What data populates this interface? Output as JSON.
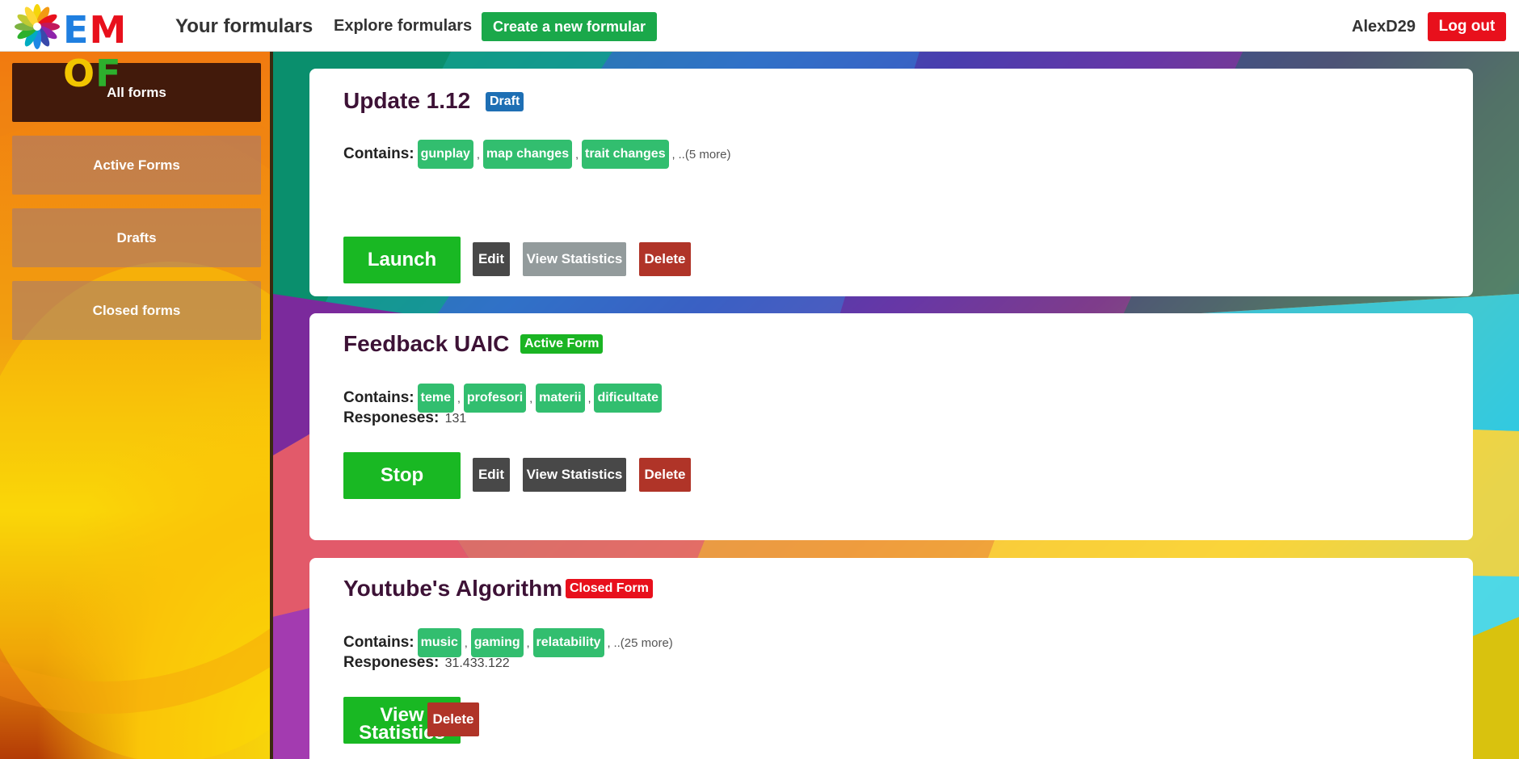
{
  "header": {
    "logo_text": [
      "E",
      "M",
      "O",
      "F"
    ],
    "logo_colors": [
      "#1f7fe0",
      "#e8101c",
      "#f2c500",
      "#2db02d"
    ],
    "your_formulars": "Your formulars",
    "explore": "Explore formulars",
    "create": "Create a new formular",
    "username": "AlexD29",
    "logout": "Log out"
  },
  "sidebar": {
    "items": [
      {
        "label": "All forms",
        "active": true
      },
      {
        "label": "Active Forms",
        "active": false
      },
      {
        "label": "Drafts",
        "active": false
      },
      {
        "label": "Closed forms",
        "active": false
      }
    ]
  },
  "cards": [
    {
      "title": "Update 1.12",
      "badge": "Draft",
      "badge_color": "#1e6fb4",
      "contains_label": "Contains:",
      "tags": [
        "gunplay",
        "map changes",
        "trait changes"
      ],
      "more": "..(5 more)",
      "responses_label": "",
      "responses": "",
      "primary": "Launch",
      "edit": "Edit",
      "stats": "View Statistics",
      "delete": "Delete"
    },
    {
      "title": "Feedback UAIC",
      "badge": "Active Form",
      "badge_color": "#1ab423",
      "contains_label": "Contains:",
      "tags": [
        "teme",
        "profesori",
        "materii",
        "dificultate"
      ],
      "more": "",
      "responses_label": "Responeses:",
      "responses": "131",
      "primary": "Stop",
      "edit": "Edit",
      "stats": "View Statistics",
      "delete": "Delete"
    },
    {
      "title": "Youtube's Algorithm",
      "badge": "Closed Form",
      "badge_color": "#e8101c",
      "contains_label": "Contains:",
      "tags": [
        "music",
        "gaming",
        "relatability"
      ],
      "more": "..(25 more)",
      "responses_label": "Responeses:",
      "responses": "31.433.122",
      "primary": "View Statistics",
      "delete": "Delete"
    }
  ]
}
